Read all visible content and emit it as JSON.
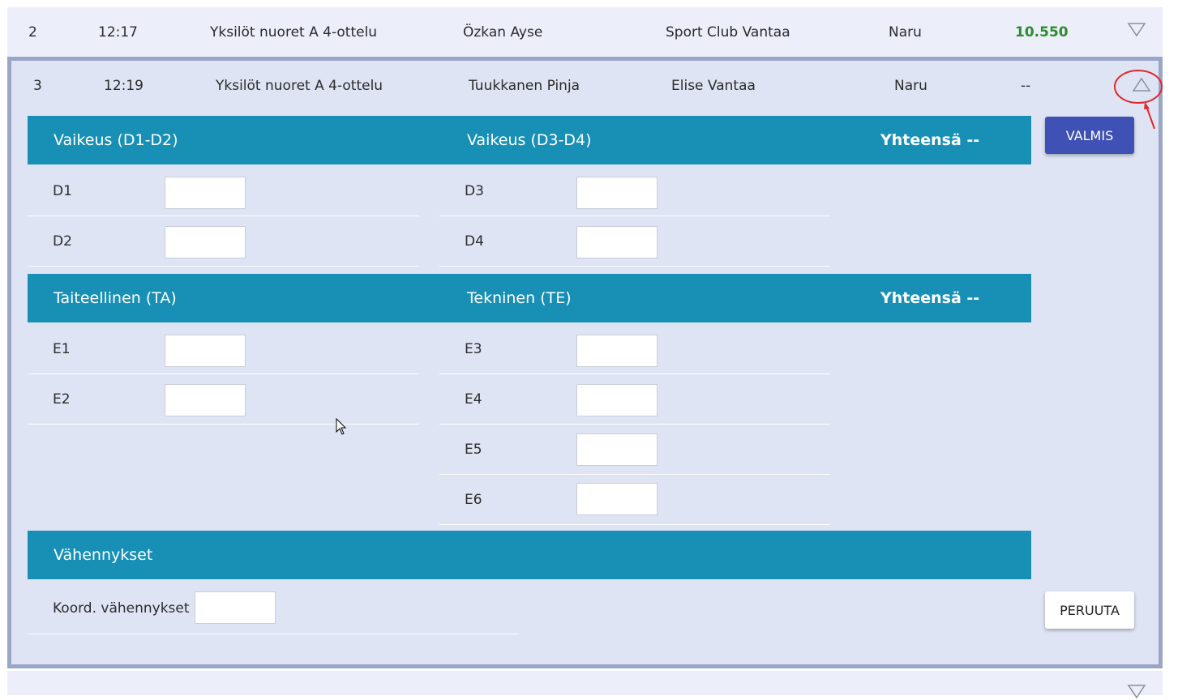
{
  "rows": [
    {
      "num": "2",
      "time": "12:17",
      "event": "Yksilöt nuoret A 4-ottelu",
      "name": "Özkan Ayse",
      "club": "Sport Club Vantaa",
      "apparatus": "Naru",
      "score": "10.550"
    },
    {
      "num": "3",
      "time": "12:19",
      "event": "Yksilöt nuoret A 4-ottelu",
      "name": "Tuukkanen Pinja",
      "club": "Elise Vantaa",
      "apparatus": "Naru",
      "score": "--"
    }
  ],
  "sections": {
    "difficulty": {
      "left_title": "Vaikeus (D1-D2)",
      "right_title": "Vaikeus (D3-D4)",
      "total": "Yhteensä --",
      "fields": [
        "D1",
        "D2",
        "D3",
        "D4"
      ]
    },
    "execution": {
      "left_title": "Taiteellinen (TA)",
      "right_title": "Tekninen (TE)",
      "total": "Yhteensä --",
      "fields": [
        "E1",
        "E2",
        "E3",
        "E4",
        "E5",
        "E6"
      ]
    },
    "deductions": {
      "title": "Vähennykset",
      "field": "Koord. vähennykset"
    }
  },
  "buttons": {
    "done": "VALMIS",
    "cancel": "PERUUTA"
  },
  "icons": {
    "expand": "chevron-down-icon",
    "collapse": "chevron-up-icon"
  },
  "colors": {
    "band": "#1890b6",
    "primary": "#3f51b5",
    "score": "#2e8b2e",
    "annotation": "#e0282a"
  }
}
